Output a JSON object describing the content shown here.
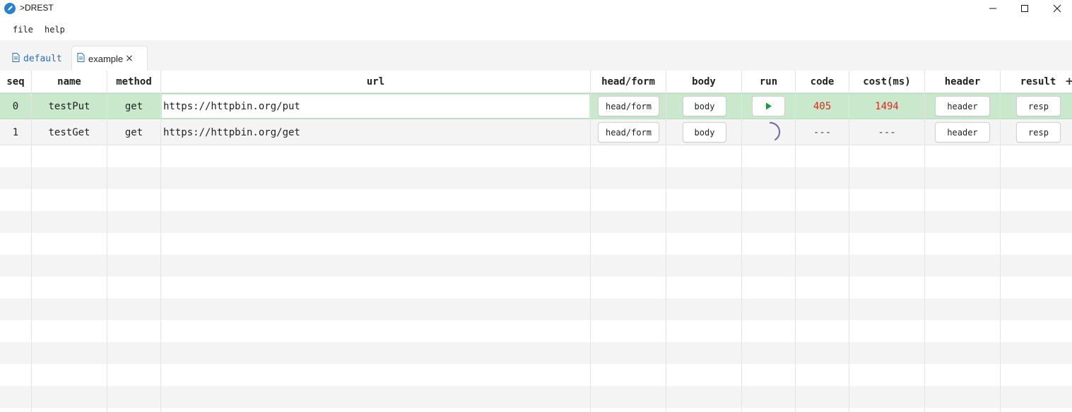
{
  "window": {
    "title": ">DREST",
    "controls": {
      "minimize": "minimize-icon",
      "maximize": "maximize-icon",
      "close": "close-icon"
    }
  },
  "menu": {
    "items": [
      "file",
      "help"
    ]
  },
  "tabs": [
    {
      "label": "default",
      "icon": "document-icon",
      "active": false
    },
    {
      "label": "example",
      "icon": "document-icon",
      "active": true,
      "close": "×"
    }
  ],
  "table": {
    "columns": [
      "seq",
      "name",
      "method",
      "url",
      "head/form",
      "body",
      "run",
      "code",
      "cost(ms)",
      "header",
      "result"
    ],
    "add_column_label": "+",
    "rows": [
      {
        "seq": "0",
        "name": "testPut",
        "method": "get",
        "url": "https://httpbin.org/put",
        "head_form": "head/form",
        "body": "body",
        "run_state": "play",
        "code": "405",
        "cost": "1494",
        "header": "header",
        "result": "resp"
      },
      {
        "seq": "1",
        "name": "testGet",
        "method": "get",
        "url": "https://httpbin.org/get",
        "head_form": "head/form",
        "body": "body",
        "run_state": "loading",
        "code": "---",
        "cost": "---",
        "header": "header",
        "result": "resp"
      }
    ]
  },
  "colors": {
    "selected_row": "#c9e8cc",
    "error_text": "#e0291d",
    "play_icon": "#1e9a3c",
    "spinner": "#7b6bb5",
    "tab_link": "#2c6fb7"
  }
}
